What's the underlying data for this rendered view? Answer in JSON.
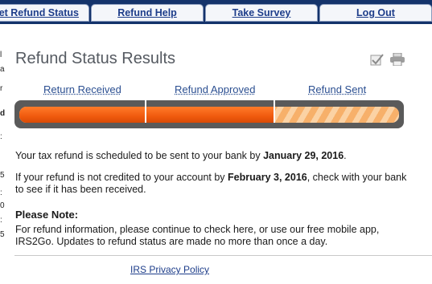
{
  "nav": {
    "tabs": [
      {
        "label": "et Refund Status"
      },
      {
        "label": "Refund Help"
      },
      {
        "label": "Take Survey"
      },
      {
        "label": "Log Out"
      }
    ]
  },
  "sidebar_fragments": [
    "l",
    "a",
    "r",
    "d",
    ":",
    "5",
    ":",
    "0",
    ":",
    "5"
  ],
  "main": {
    "title": "Refund Status Results",
    "icons": {
      "check": "checkbox-check-icon",
      "print": "printer-icon"
    },
    "progress": {
      "steps": [
        "Return Received",
        "Refund Approved",
        "Refund Sent"
      ],
      "completed_fraction": 0.67,
      "fill_color": "#f05a0e",
      "pending_color": "#f7b06a"
    },
    "message1": {
      "pre": "Your tax refund is scheduled to be sent to your bank by ",
      "date": "January 29, 2016",
      "post": "."
    },
    "message2": {
      "pre": "If your refund is not credited to your account by ",
      "date": "February 3, 2016",
      "post": ", check with your bank to see if it has been received."
    },
    "note_heading": "Please Note:",
    "note_text": "For refund information, please continue to check here, or use our free mobile app, IRS2Go. Updates to refund status are made no more than once a day."
  },
  "footer": {
    "privacy_link": "IRS Privacy Policy"
  },
  "colors": {
    "nav_bg": "#14336b",
    "link": "#1d3d8a",
    "accent": "#f05a0e"
  }
}
